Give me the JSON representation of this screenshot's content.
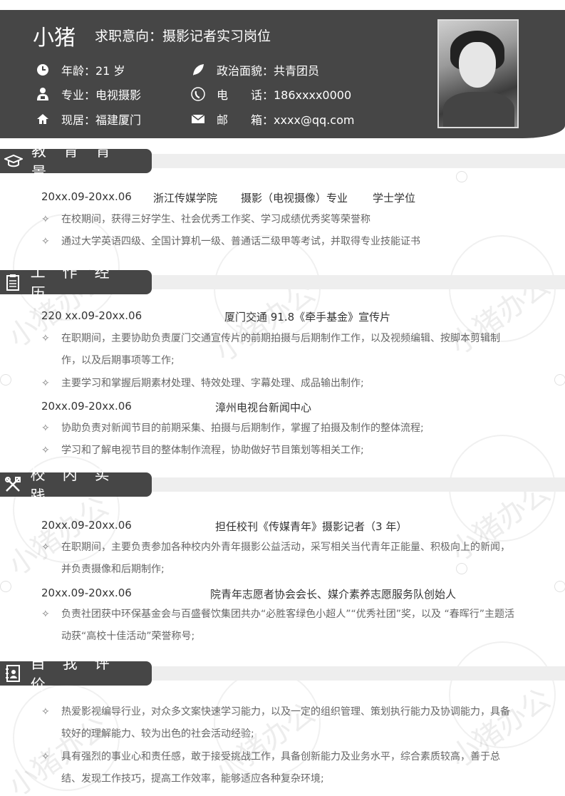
{
  "header": {
    "name": "小猪",
    "intent_label": "求职意向：",
    "intent_value": "摄影记者实习岗位",
    "age": "年龄：21 岁",
    "political": "政治面貌：共青团员",
    "major": "专业：电视摄影",
    "phone": "电　　话：186xxxx0000",
    "residence": "现居：福建厦门",
    "email": "邮　　箱：xxxx@qq.com"
  },
  "sections": {
    "education": {
      "title": "教育背景",
      "date": "20xx.09-20xx.06",
      "school": "浙江传媒学院",
      "major": "摄影（电视摄像）专业",
      "degree": "学士学位",
      "bullets": [
        "在校期间，获得三好学生、社会优秀工作奖、学习成绩优秀奖等荣誉称",
        "通过大学英语四级、全国计算机一级、普通话二级甲等考试，并取得专业技能证书"
      ]
    },
    "work": {
      "title": "工作经历",
      "job1_date": "220 xx.09-20xx.06",
      "job1_org": "厦门交通 91.8《牵手基金》宣传片",
      "job1_bullets": [
        "在职期间，主要协助负责厦门交通宣传片的前期拍摄与后期制作工作，以及视频编辑、按脚本剪辑制作，以及后期事项等工作;",
        "主要学习和掌握后期素材处理、特效处理、字幕处理、成品输出制作;"
      ],
      "job2_date": "20xx.09-20xx.06",
      "job2_org": "漳州电视台新闻中心",
      "job2_bullets": [
        "协助负责对新闻节目的前期采集、拍摄与后期制作，掌握了拍摄及制作的整体流程;",
        "学习和了解电视节目的整体制作流程，协助做好节目策划等相关工作;"
      ]
    },
    "campus": {
      "title": "校内实践",
      "item1_date": "20xx.09-20xx.06",
      "item1_role": "担任校刊《传媒青年》摄影记者（3 年）",
      "item1_bullets": [
        "在职期间，主要负责参加各种校内外青年摄影公益活动，采写相关当代青年正能量、积极向上的新闻，并负责摄像和后期制作;"
      ],
      "item2_date": "20xx.09-20xx.06",
      "item2_role": "院青年志愿者协会会长、媒介素养志愿服务队创始人",
      "item2_bullets": [
        "负责社团获中环保基金会与百盛餐饮集团共办“必胜客绿色小超人”“优秀社团”奖，以及 “春晖行”主题活动获“高校十佳活动”荣誉称号;"
      ]
    },
    "self": {
      "title": "自我评价",
      "bullets": [
        "热爱影视编导行业，对众多文案快速学习能力，以及一定的组织管理、策划执行能力及协调能力，具备较好的理解能力、较为出色的社会活动经验;",
        "具有强烈的事业心和责任感，敢于接受挑战工作，具备创新能力及业务水平，综合素质较高，善于总结、发现工作技巧，提高工作效率，能够适应各种复杂环境;"
      ]
    }
  },
  "bullet_mark": "✧",
  "watermark": "小猪办公",
  "icons": [
    "clock-icon",
    "leaf-icon",
    "person-icon",
    "phone-icon",
    "home-icon",
    "mail-icon",
    "graduation-cap-icon",
    "clipboard-icon",
    "tools-icon",
    "notebook-icon"
  ],
  "colors": {
    "header_bg": "#464646",
    "band": "#eeeeee",
    "text": "#333333",
    "muted": "#666666"
  }
}
